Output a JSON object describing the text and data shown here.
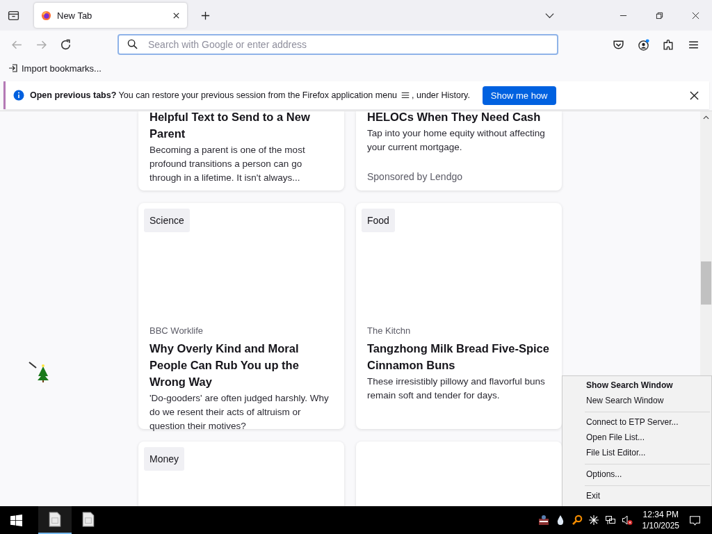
{
  "tabs": [
    {
      "title": "New Tab",
      "selected": true
    }
  ],
  "address_bar": {
    "placeholder": "Search with Google or enter address"
  },
  "bookmarks_toolbar": {
    "import_label": "Import bookmarks..."
  },
  "notification": {
    "text": "**Open previous tabs?** You can restore your previous session from the Firefox application menu",
    "text_after": ", under History.",
    "button": "Show me how"
  },
  "cards": [
    {
      "kind": "text",
      "title": "Helpful Text to Send to a New Parent",
      "excerpt": "Becoming a parent is one of the most profound transitions a person can go through in a lifetime. It isn't always..."
    },
    {
      "kind": "text",
      "title": "HELOCs When They Need Cash",
      "excerpt": "Tap into your home equity without affecting your current mortgage.",
      "sponsor": "Sponsored by Lendgo"
    },
    {
      "kind": "image",
      "tag": "Science",
      "source": "BBC Worklife",
      "title": "Why Overly Kind and Moral People Can Rub You up the Wrong Way",
      "excerpt": "'Do-gooders' are often judged harshly. Why do we resent their acts of altruism or question their motives?"
    },
    {
      "kind": "image",
      "tag": "Food",
      "source": "The Kitchn",
      "title": "Tangzhong Milk Bread Five-Spice Cinnamon Buns",
      "excerpt": "These irresistibly pillowy and flavorful buns remain soft and tender for days."
    },
    {
      "kind": "image",
      "tag": "Money"
    },
    {
      "kind": "blank"
    }
  ],
  "context_menu": {
    "groups": [
      [
        {
          "label": "Show Search Window",
          "default": true
        },
        {
          "label": "New Search Window",
          "default": false
        }
      ],
      [
        {
          "label": "Connect to ETP Server...",
          "default": false
        },
        {
          "label": "Open File List...",
          "default": false
        },
        {
          "label": "File List Editor...",
          "default": false
        }
      ],
      [
        {
          "label": "Options...",
          "default": false
        }
      ],
      [
        {
          "label": "Exit",
          "default": false
        }
      ]
    ]
  },
  "taskbar": {
    "apps": [
      {
        "selected": true
      },
      {
        "selected": false
      }
    ],
    "time": "12:34 PM",
    "date": "1/10/2025"
  }
}
